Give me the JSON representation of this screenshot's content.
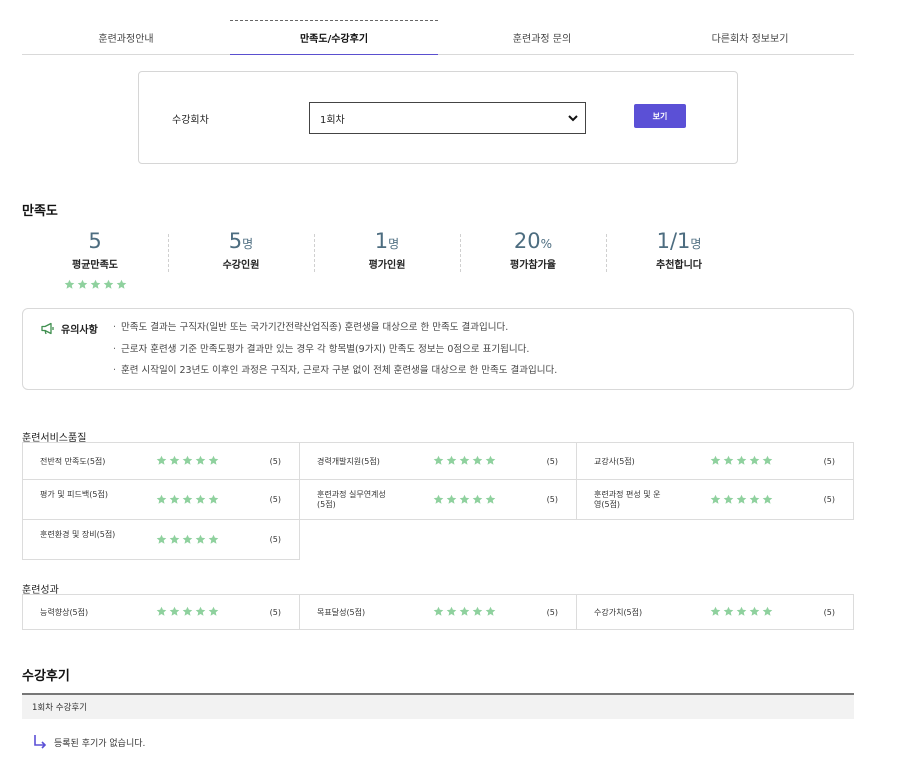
{
  "tabs": [
    {
      "label": "훈련과정안내"
    },
    {
      "label": "만족도/수강후기"
    },
    {
      "label": "훈련과정 문의"
    },
    {
      "label": "다른회차 정보보기"
    }
  ],
  "session": {
    "label": "수강회차",
    "selected": "1회차",
    "button": "보기"
  },
  "satisfaction": {
    "title": "만족도",
    "stats": [
      {
        "value": "5",
        "unit": "",
        "label": "평균만족도",
        "stars": 5
      },
      {
        "value": "5",
        "unit": "명",
        "label": "수강인원"
      },
      {
        "value": "1",
        "unit": "명",
        "label": "평가인원"
      },
      {
        "value": "20",
        "unit": "%",
        "label": "평가참가율"
      },
      {
        "value": "1/1",
        "unit": "명",
        "label": "추천합니다"
      }
    ]
  },
  "notice": {
    "title": "유의사항",
    "items": [
      "만족도 결과는 구직자(일반 또는 국가기간전략산업직종) 훈련생을 대상으로 한 만족도 결과입니다.",
      "근로자 훈련생 기준 만족도평가 결과만 있는 경우 각 항목별(9가지) 만족도 정보는 0점으로 표기됩니다.",
      "훈련 시작일이 23년도 이후인 과정은 구직자, 근로자 구분 없이 전체 훈련생을 대상으로 한 만족도 결과입니다."
    ]
  },
  "service_quality": {
    "title": "훈련서비스품질",
    "items": [
      {
        "name": "전반적 만족도(5점)",
        "score": "(5)",
        "stars": 5
      },
      {
        "name": "경력개발지원(5점)",
        "score": "(5)",
        "stars": 5
      },
      {
        "name": "교강사(5점)",
        "score": "(5)",
        "stars": 5
      },
      {
        "name": "평가 및 피드백(5점)",
        "score": "(5)",
        "stars": 5
      },
      {
        "name": "훈련과정 실무연계성(5점)",
        "score": "(5)",
        "stars": 5
      },
      {
        "name": "훈련과정 편성 및 운영(5점)",
        "score": "(5)",
        "stars": 5
      },
      {
        "name": "훈련환경 및 장비(5점)",
        "score": "(5)",
        "stars": 5
      }
    ]
  },
  "outcome": {
    "title": "훈련성과",
    "items": [
      {
        "name": "능력향상(5점)",
        "score": "(5)",
        "stars": 5
      },
      {
        "name": "목표달성(5점)",
        "score": "(5)",
        "stars": 5
      },
      {
        "name": "수강가치(5점)",
        "score": "(5)",
        "stars": 5
      }
    ]
  },
  "reviews": {
    "title": "수강후기",
    "bar_label": "1회차 수강후기",
    "empty_text": "등록된 후기가 없습니다."
  },
  "colors": {
    "accent": "#5b50d6",
    "star": "#8fd19e",
    "stat_number": "#4d6d80"
  }
}
